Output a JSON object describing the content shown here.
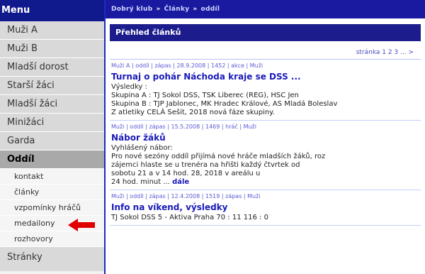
{
  "sidebar": {
    "title": "Menu",
    "items": [
      {
        "label": "Muži A"
      },
      {
        "label": "Muži B"
      },
      {
        "label": "Mladší dorost"
      },
      {
        "label": "Starší žáci"
      },
      {
        "label": "Mladší žáci"
      },
      {
        "label": "Minižáci"
      },
      {
        "label": "Garda"
      },
      {
        "label": "Oddíl"
      }
    ],
    "subitems": [
      {
        "label": "kontakt"
      },
      {
        "label": "články"
      },
      {
        "label": "vzpomínky hráčů"
      },
      {
        "label": "medailony"
      },
      {
        "label": "rozhovory"
      }
    ],
    "footer_item": {
      "label": "Stránky"
    }
  },
  "breadcrumb": {
    "items": [
      "Dobrý klub",
      "Články",
      "oddíl"
    ]
  },
  "main": {
    "section_title": "Přehled článků",
    "pager": "stránka 1 2 3 ... >",
    "articles": [
      {
        "meta": "Muži A | oddíl | zápas | 28.9.2008 | 1452 | akce | Muži",
        "headline": "Turnaj o pohár Náchoda kraje se DSS ...",
        "body": [
          "Výsledky :",
          "Skupina A : TJ Sokol DSS, TSK Liberec (REG), HSC Jen",
          "Skupina B : TJP Jablonec, MK Hradec Králové, AS Mladá Boleslav",
          "Z atletiky CELÁ Sešit, 2018 nová fáze skupiny."
        ],
        "more": ""
      },
      {
        "meta": "Muži | oddíl | zápas | 15.5.2008 | 1469 | hráč | Muži",
        "headline": "Nábor žáků",
        "body": [
          "Vyhlášený nábor:",
          "Pro nové sezóny oddíl přijímá nové hráče mladších žáků, roz",
          "zájemci hlaste se u trenéra na hřišti každý čtvrtek od",
          "sobotu 21 a v 14 hod. 28, 2018 v areálu u",
          "24 hod. minut ..."
        ],
        "more": "dále"
      },
      {
        "meta": "Muži | oddíl | zápas | 12.4.2008 | 1519 | zápas | Muži",
        "headline": "Info na víkend, výsledky",
        "body": [
          "TJ Sokol DSS 5 - Aktiva Praha 70 : 11 116 : 0"
        ],
        "more": ""
      }
    ]
  },
  "colors": {
    "accent": "#1a1aa0",
    "sidebar_header": "#111a8c",
    "active_menu": "#a9a9a9",
    "arrow": "#e00000"
  }
}
